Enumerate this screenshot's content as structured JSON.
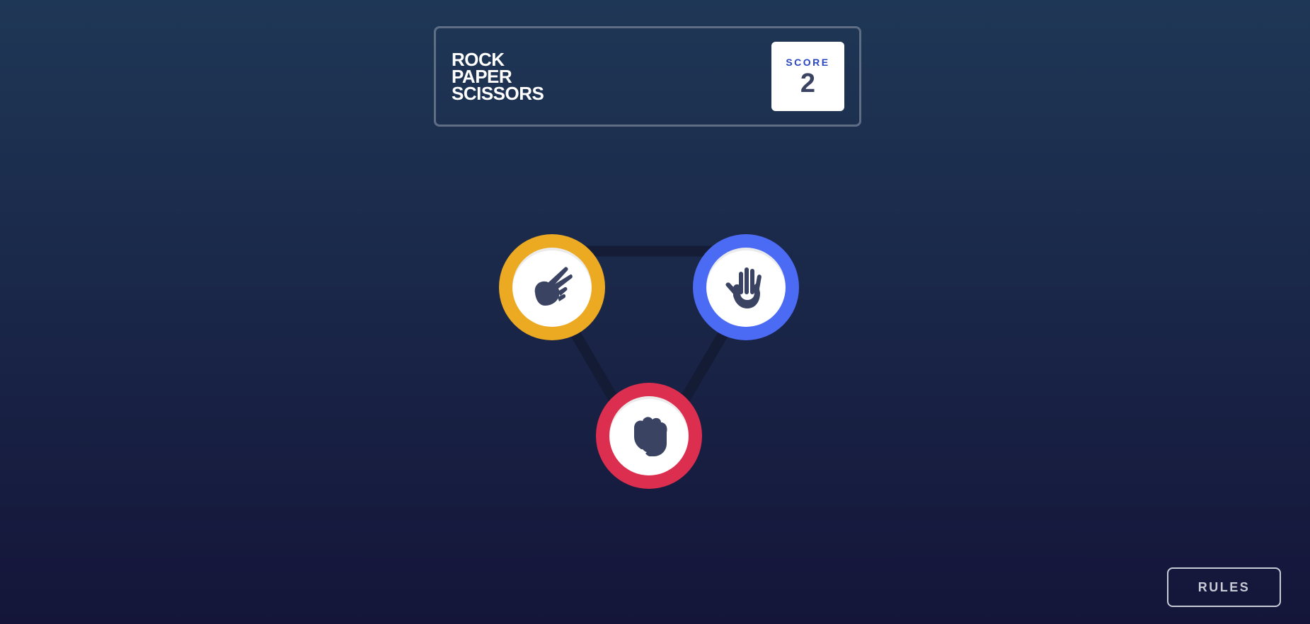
{
  "header": {
    "logo_lines": [
      "ROCK",
      "PAPER",
      "SCISSORS"
    ],
    "score_label": "SCORE",
    "score_value": "2"
  },
  "tokens": [
    {
      "name": "scissors",
      "color": "#eca922",
      "icon": "scissors-hand-icon"
    },
    {
      "name": "paper",
      "color": "#4c6bf4",
      "icon": "paper-hand-icon"
    },
    {
      "name": "rock",
      "color": "#dc2e4e",
      "icon": "rock-fist-icon"
    }
  ],
  "rules_button": {
    "label": "RULES"
  },
  "colors": {
    "background_top": "#1f3756",
    "background_bottom": "#141539",
    "header_border": "#606e85",
    "score_label": "#2a46c0",
    "score_value": "#3b4363",
    "icon_fill": "#3b4363"
  }
}
